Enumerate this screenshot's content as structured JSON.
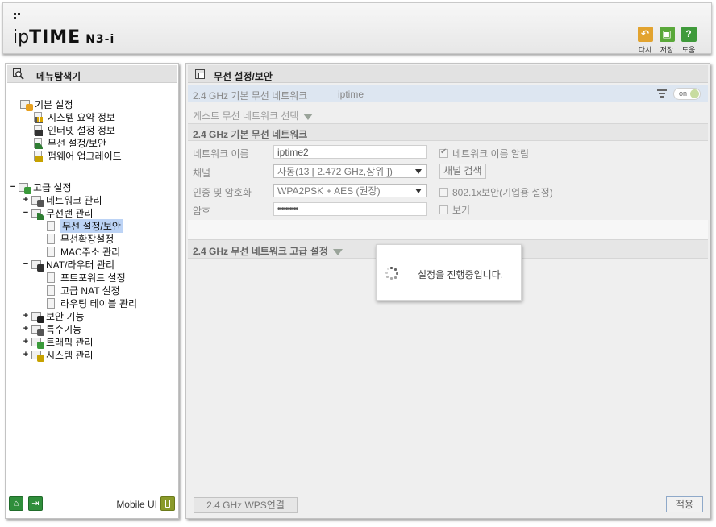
{
  "header": {
    "brand": "ipTIME",
    "model": "N3-i",
    "buttons": [
      {
        "label": "다시",
        "icon": "undo-icon",
        "color": "#e2a32f"
      },
      {
        "label": "저장",
        "icon": "save-icon",
        "color": "#5aa83a"
      },
      {
        "label": "도움",
        "icon": "help-icon",
        "color": "#3f9a3b"
      }
    ]
  },
  "sidebar": {
    "title": "메뉴탐색기",
    "groups": [
      {
        "label": "기본 설정",
        "items": [
          "시스템 요약 정보",
          "인터넷 설정 정보",
          "무선 설정/보안",
          "펌웨어 업그레이드"
        ]
      },
      {
        "label": "고급 설정",
        "toggle": "−",
        "children": [
          {
            "label": "네트워크 관리",
            "toggle": "+"
          },
          {
            "label": "무선랜 관리",
            "toggle": "−",
            "items": [
              "무선 설정/보안",
              "무선확장설정",
              "MAC주소 관리"
            ]
          },
          {
            "label": "NAT/라우터 관리",
            "toggle": "−",
            "items": [
              "포트포워드 설정",
              "고급 NAT 설정",
              "라우팅 테이블 관리"
            ]
          },
          {
            "label": "보안 기능",
            "toggle": "+"
          },
          {
            "label": "특수기능",
            "toggle": "+"
          },
          {
            "label": "트래픽 관리",
            "toggle": "+"
          },
          {
            "label": "시스템 관리",
            "toggle": "+"
          }
        ]
      }
    ],
    "footer": {
      "mobile_label": "Mobile UI"
    }
  },
  "main": {
    "title": "무선 설정/보안",
    "network_bar": {
      "label": "2.4 GHz 기본 무선 네트워크",
      "ssid": "iptime",
      "toggle": "on"
    },
    "guest_select": "게스트 무선 네트워크 선택",
    "basic_section": {
      "title": "2.4 GHz 기본 무선 네트워크",
      "network_name_label": "네트워크 이름",
      "network_name_value": "iptime2",
      "broadcast_label": "네트워크 이름 알림",
      "broadcast_checked": true,
      "channel_label": "채널",
      "channel_value": "자동(13 [ 2.472 GHz,상위 ])",
      "channel_search_label": "채널 검색",
      "auth_label": "인증 및 암호화",
      "auth_value": "WPA2PSK + AES (권장)",
      "enterprise_label": "802.1x보안(기업용 설정)",
      "enterprise_checked": false,
      "password_label": "암호",
      "password_value": "••••••••••",
      "show_label": "보기",
      "show_checked": false
    },
    "advanced_section": {
      "title": "2.4 GHz 무선 네트워크 고급 설정"
    },
    "wps_button": "2.4 GHz WPS연결",
    "apply_button": "적용"
  },
  "dialog": {
    "message": "설정을 진행중입니다."
  }
}
